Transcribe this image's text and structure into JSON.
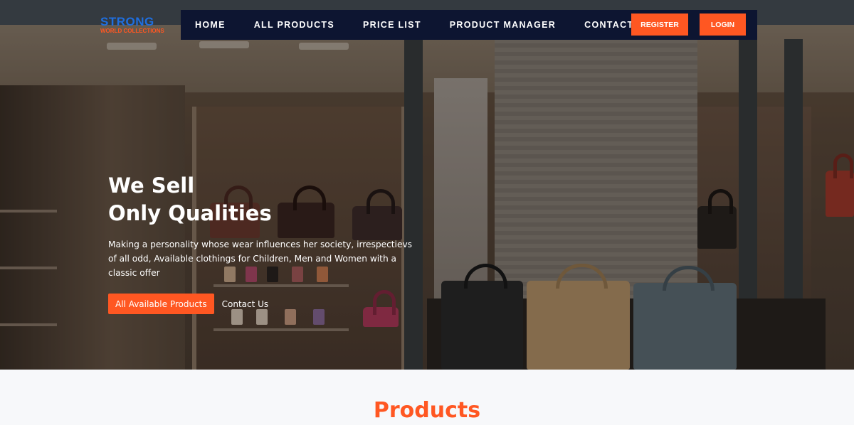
{
  "brand": {
    "name": "STRONG",
    "tagline": "WORLD COLLECTIONS"
  },
  "nav": {
    "links": [
      "HOME",
      "ALL PRODUCTS",
      "PRICE LIST",
      "PRODUCT MANAGER",
      "CONTACT"
    ],
    "register_label": "REGISTER",
    "login_label": "LOGIN"
  },
  "hero": {
    "title_line1": "We Sell",
    "title_line2": "Only Qualities",
    "description": "Making a personality whose wear influences her society, irrespectievs of all odd, Available clothings for Children, Men and Women with a classic offer",
    "primary_button": "All Available Products",
    "secondary_link": "Contact Us"
  },
  "products": {
    "heading": "Products"
  },
  "colors": {
    "accent": "#ff5722",
    "nav_bg": "#0d1531",
    "brand_blue": "#1f6fe0"
  }
}
